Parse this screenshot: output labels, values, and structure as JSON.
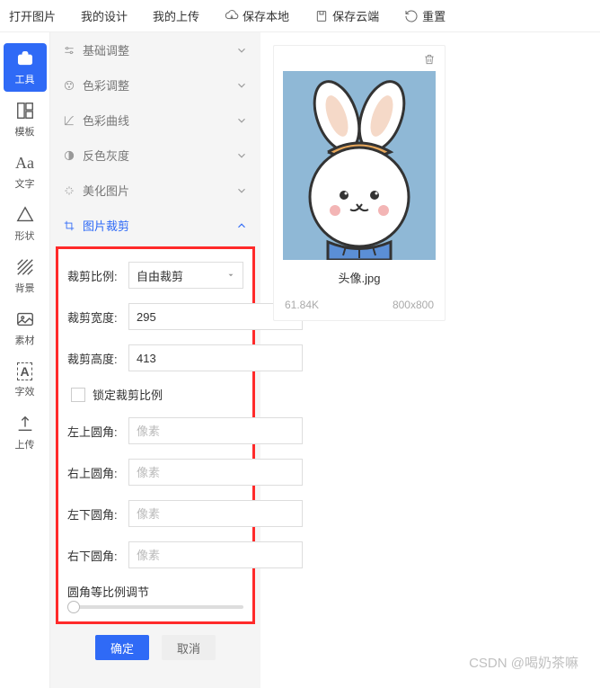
{
  "topbar": {
    "open_image": "打开图片",
    "my_design": "我的设计",
    "my_upload": "我的上传",
    "save_local": "保存本地",
    "save_cloud": "保存云端",
    "reset": "重置"
  },
  "sidebar": {
    "items": [
      {
        "label": "工具"
      },
      {
        "label": "模板"
      },
      {
        "label": "文字"
      },
      {
        "label": "形状"
      },
      {
        "label": "背景"
      },
      {
        "label": "素材"
      },
      {
        "label": "字效"
      },
      {
        "label": "上传"
      }
    ]
  },
  "accordion": {
    "basic_adjust": "基础调整",
    "color_adjust": "色彩调整",
    "color_curve": "色彩曲线",
    "invert_gray": "反色灰度",
    "beautify": "美化图片",
    "image_crop": "图片裁剪"
  },
  "crop": {
    "ratio_label": "裁剪比例:",
    "ratio_value": "自由裁剪",
    "width_label": "裁剪宽度:",
    "width_value": "295",
    "height_label": "裁剪高度:",
    "height_value": "413",
    "lock_ratio": "锁定裁剪比例",
    "tl_label": "左上圆角:",
    "tr_label": "右上圆角:",
    "bl_label": "左下圆角:",
    "br_label": "右下圆角:",
    "pixel_placeholder": "像素",
    "slider_label": "圆角等比例调节",
    "confirm": "确定",
    "cancel": "取消"
  },
  "thumb": {
    "filename": "头像.jpg",
    "filesize": "61.84K",
    "dimensions": "800x800"
  },
  "watermark": "CSDN @喝奶茶嘛"
}
